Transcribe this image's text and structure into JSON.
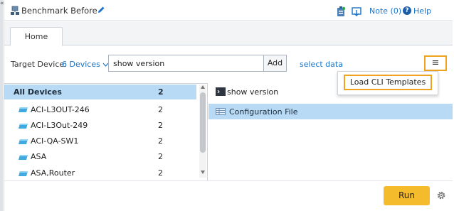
{
  "window": {
    "title": "Benchmark Before",
    "collapse_glyph": "«"
  },
  "header_right": {
    "note_label": "Note (0)",
    "help_label": "Help",
    "help_glyph": "?"
  },
  "tabs": [
    {
      "label": "Home",
      "selected": true
    }
  ],
  "toolbar": {
    "target_device_label": "Target Device:",
    "target_device_link": "6 Devices",
    "command_value": "show version",
    "add_label": "Add",
    "select_data_label": "select data",
    "menu_glyph": "≡"
  },
  "menu": {
    "items": [
      {
        "label": "Load CLI Templates"
      }
    ]
  },
  "device_list": {
    "all": {
      "label": "All Devices",
      "count": "2"
    },
    "items": [
      {
        "label": "ACI-L3OUT-246",
        "count": "2"
      },
      {
        "label": "ACI-L3Out-249",
        "count": "2"
      },
      {
        "label": "ACI-QA-SW1",
        "count": "2"
      },
      {
        "label": "ASA",
        "count": "2"
      },
      {
        "label": "ASA,Router",
        "count": "2"
      }
    ]
  },
  "commands": {
    "command_label": "show version",
    "selected_item": "Configuration File"
  },
  "footer": {
    "run_label": "Run"
  },
  "colors": {
    "accent": "#f0a31f",
    "link": "#1a73c8",
    "selection": "#b8daf5",
    "run_button": "#f4bb2c"
  }
}
